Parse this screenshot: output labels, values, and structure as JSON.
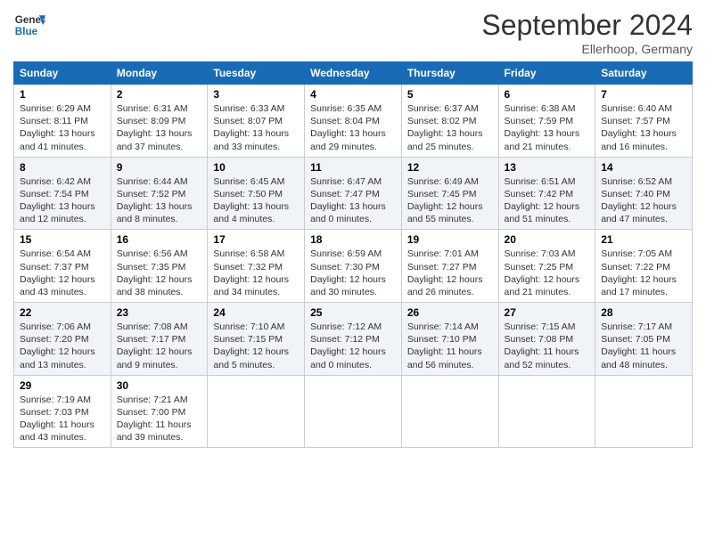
{
  "header": {
    "logo_line1": "General",
    "logo_line2": "Blue",
    "month_title": "September 2024",
    "subtitle": "Ellerhoop, Germany"
  },
  "weekdays": [
    "Sunday",
    "Monday",
    "Tuesday",
    "Wednesday",
    "Thursday",
    "Friday",
    "Saturday"
  ],
  "weeks": [
    [
      {
        "day": "1",
        "info": "Sunrise: 6:29 AM\nSunset: 8:11 PM\nDaylight: 13 hours\nand 41 minutes."
      },
      {
        "day": "2",
        "info": "Sunrise: 6:31 AM\nSunset: 8:09 PM\nDaylight: 13 hours\nand 37 minutes."
      },
      {
        "day": "3",
        "info": "Sunrise: 6:33 AM\nSunset: 8:07 PM\nDaylight: 13 hours\nand 33 minutes."
      },
      {
        "day": "4",
        "info": "Sunrise: 6:35 AM\nSunset: 8:04 PM\nDaylight: 13 hours\nand 29 minutes."
      },
      {
        "day": "5",
        "info": "Sunrise: 6:37 AM\nSunset: 8:02 PM\nDaylight: 13 hours\nand 25 minutes."
      },
      {
        "day": "6",
        "info": "Sunrise: 6:38 AM\nSunset: 7:59 PM\nDaylight: 13 hours\nand 21 minutes."
      },
      {
        "day": "7",
        "info": "Sunrise: 6:40 AM\nSunset: 7:57 PM\nDaylight: 13 hours\nand 16 minutes."
      }
    ],
    [
      {
        "day": "8",
        "info": "Sunrise: 6:42 AM\nSunset: 7:54 PM\nDaylight: 13 hours\nand 12 minutes."
      },
      {
        "day": "9",
        "info": "Sunrise: 6:44 AM\nSunset: 7:52 PM\nDaylight: 13 hours\nand 8 minutes."
      },
      {
        "day": "10",
        "info": "Sunrise: 6:45 AM\nSunset: 7:50 PM\nDaylight: 13 hours\nand 4 minutes."
      },
      {
        "day": "11",
        "info": "Sunrise: 6:47 AM\nSunset: 7:47 PM\nDaylight: 13 hours\nand 0 minutes."
      },
      {
        "day": "12",
        "info": "Sunrise: 6:49 AM\nSunset: 7:45 PM\nDaylight: 12 hours\nand 55 minutes."
      },
      {
        "day": "13",
        "info": "Sunrise: 6:51 AM\nSunset: 7:42 PM\nDaylight: 12 hours\nand 51 minutes."
      },
      {
        "day": "14",
        "info": "Sunrise: 6:52 AM\nSunset: 7:40 PM\nDaylight: 12 hours\nand 47 minutes."
      }
    ],
    [
      {
        "day": "15",
        "info": "Sunrise: 6:54 AM\nSunset: 7:37 PM\nDaylight: 12 hours\nand 43 minutes."
      },
      {
        "day": "16",
        "info": "Sunrise: 6:56 AM\nSunset: 7:35 PM\nDaylight: 12 hours\nand 38 minutes."
      },
      {
        "day": "17",
        "info": "Sunrise: 6:58 AM\nSunset: 7:32 PM\nDaylight: 12 hours\nand 34 minutes."
      },
      {
        "day": "18",
        "info": "Sunrise: 6:59 AM\nSunset: 7:30 PM\nDaylight: 12 hours\nand 30 minutes."
      },
      {
        "day": "19",
        "info": "Sunrise: 7:01 AM\nSunset: 7:27 PM\nDaylight: 12 hours\nand 26 minutes."
      },
      {
        "day": "20",
        "info": "Sunrise: 7:03 AM\nSunset: 7:25 PM\nDaylight: 12 hours\nand 21 minutes."
      },
      {
        "day": "21",
        "info": "Sunrise: 7:05 AM\nSunset: 7:22 PM\nDaylight: 12 hours\nand 17 minutes."
      }
    ],
    [
      {
        "day": "22",
        "info": "Sunrise: 7:06 AM\nSunset: 7:20 PM\nDaylight: 12 hours\nand 13 minutes."
      },
      {
        "day": "23",
        "info": "Sunrise: 7:08 AM\nSunset: 7:17 PM\nDaylight: 12 hours\nand 9 minutes."
      },
      {
        "day": "24",
        "info": "Sunrise: 7:10 AM\nSunset: 7:15 PM\nDaylight: 12 hours\nand 5 minutes."
      },
      {
        "day": "25",
        "info": "Sunrise: 7:12 AM\nSunset: 7:12 PM\nDaylight: 12 hours\nand 0 minutes."
      },
      {
        "day": "26",
        "info": "Sunrise: 7:14 AM\nSunset: 7:10 PM\nDaylight: 11 hours\nand 56 minutes."
      },
      {
        "day": "27",
        "info": "Sunrise: 7:15 AM\nSunset: 7:08 PM\nDaylight: 11 hours\nand 52 minutes."
      },
      {
        "day": "28",
        "info": "Sunrise: 7:17 AM\nSunset: 7:05 PM\nDaylight: 11 hours\nand 48 minutes."
      }
    ],
    [
      {
        "day": "29",
        "info": "Sunrise: 7:19 AM\nSunset: 7:03 PM\nDaylight: 11 hours\nand 43 minutes."
      },
      {
        "day": "30",
        "info": "Sunrise: 7:21 AM\nSunset: 7:00 PM\nDaylight: 11 hours\nand 39 minutes."
      },
      {
        "day": "",
        "info": ""
      },
      {
        "day": "",
        "info": ""
      },
      {
        "day": "",
        "info": ""
      },
      {
        "day": "",
        "info": ""
      },
      {
        "day": "",
        "info": ""
      }
    ]
  ]
}
